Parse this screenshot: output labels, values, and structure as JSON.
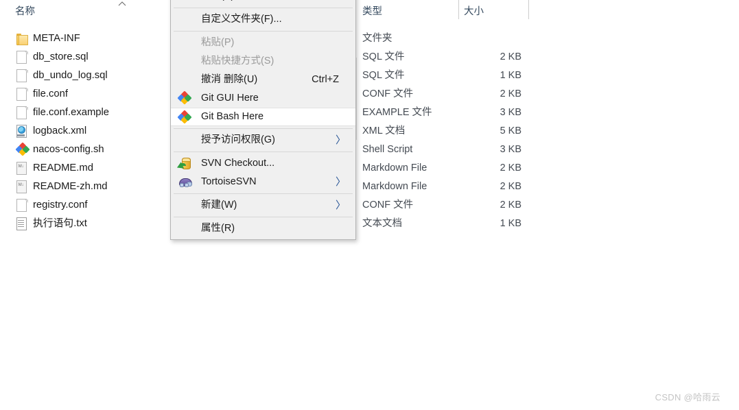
{
  "explorer": {
    "columns": {
      "name": "名称",
      "type": "类型",
      "size": "大小"
    },
    "sort_indicator": "sort-ascending-chevron",
    "rows": [
      {
        "name": "META-INF",
        "icon": "folder-icon",
        "type": "文件夹",
        "size": ""
      },
      {
        "name": "db_store.sql",
        "icon": "file-icon",
        "type": "SQL 文件",
        "size": "2 KB"
      },
      {
        "name": "db_undo_log.sql",
        "icon": "file-icon",
        "type": "SQL 文件",
        "size": "1 KB"
      },
      {
        "name": "file.conf",
        "icon": "file-icon",
        "type": "CONF 文件",
        "size": "2 KB"
      },
      {
        "name": "file.conf.example",
        "icon": "file-icon",
        "type": "EXAMPLE 文件",
        "size": "3 KB"
      },
      {
        "name": "logback.xml",
        "icon": "xml-icon",
        "type": "XML 文档",
        "size": "5 KB"
      },
      {
        "name": "nacos-config.sh",
        "icon": "git-icon",
        "type": "Shell Script",
        "size": "3 KB"
      },
      {
        "name": "README.md",
        "icon": "markdown-icon",
        "type": "Markdown File",
        "size": "2 KB"
      },
      {
        "name": "README-zh.md",
        "icon": "markdown-icon",
        "type": "Markdown File",
        "size": "2 KB"
      },
      {
        "name": "registry.conf",
        "icon": "file-icon",
        "type": "CONF 文件",
        "size": "2 KB"
      },
      {
        "name": "执行语句.txt",
        "icon": "text-icon",
        "type": "文本文档",
        "size": "1 KB"
      }
    ]
  },
  "context_menu": {
    "items": [
      {
        "label": "刷新(E)",
        "type": "item",
        "icon": "",
        "accel": "",
        "submenu": false,
        "disabled": false,
        "highlighted": false
      },
      {
        "label": "",
        "type": "separator"
      },
      {
        "label": "自定义文件夹(F)...",
        "type": "item",
        "icon": "",
        "accel": "",
        "submenu": false,
        "disabled": false,
        "highlighted": false
      },
      {
        "label": "",
        "type": "separator"
      },
      {
        "label": "粘贴(P)",
        "type": "item",
        "icon": "",
        "accel": "",
        "submenu": false,
        "disabled": true,
        "highlighted": false
      },
      {
        "label": "粘贴快捷方式(S)",
        "type": "item",
        "icon": "",
        "accel": "",
        "submenu": false,
        "disabled": true,
        "highlighted": false
      },
      {
        "label": "撤消 删除(U)",
        "type": "item",
        "icon": "",
        "accel": "Ctrl+Z",
        "submenu": false,
        "disabled": false,
        "highlighted": false
      },
      {
        "label": "Git GUI Here",
        "type": "item",
        "icon": "git-icon",
        "accel": "",
        "submenu": false,
        "disabled": false,
        "highlighted": false
      },
      {
        "label": "Git Bash Here",
        "type": "item",
        "icon": "git-icon",
        "accel": "",
        "submenu": false,
        "disabled": false,
        "highlighted": true
      },
      {
        "label": "",
        "type": "separator"
      },
      {
        "label": "授予访问权限(G)",
        "type": "item",
        "icon": "",
        "accel": "",
        "submenu": true,
        "disabled": false,
        "highlighted": false
      },
      {
        "label": "",
        "type": "separator"
      },
      {
        "label": "SVN Checkout...",
        "type": "item",
        "icon": "svn-checkout-icon",
        "accel": "",
        "submenu": false,
        "disabled": false,
        "highlighted": false
      },
      {
        "label": "TortoiseSVN",
        "type": "item",
        "icon": "tortoise-icon",
        "accel": "",
        "submenu": true,
        "disabled": false,
        "highlighted": false
      },
      {
        "label": "",
        "type": "separator"
      },
      {
        "label": "新建(W)",
        "type": "item",
        "icon": "",
        "accel": "",
        "submenu": true,
        "disabled": false,
        "highlighted": false
      },
      {
        "label": "",
        "type": "separator"
      },
      {
        "label": "属性(R)",
        "type": "item",
        "icon": "",
        "accel": "",
        "submenu": false,
        "disabled": false,
        "highlighted": false
      }
    ],
    "submenu_arrow_glyph": "〉"
  },
  "watermark": {
    "text": "CSDN @哈雨云"
  },
  "colors": {
    "menu_background": "#f0f0f0",
    "menu_border": "#b3b3b3",
    "highlight_background": "#ffffff",
    "header_text": "#34495e",
    "disabled_text": "#9a9a9a",
    "submenu_arrow": "#2b5797",
    "watermark_text": "#c4c4c4",
    "page_background": "#ffffff"
  }
}
